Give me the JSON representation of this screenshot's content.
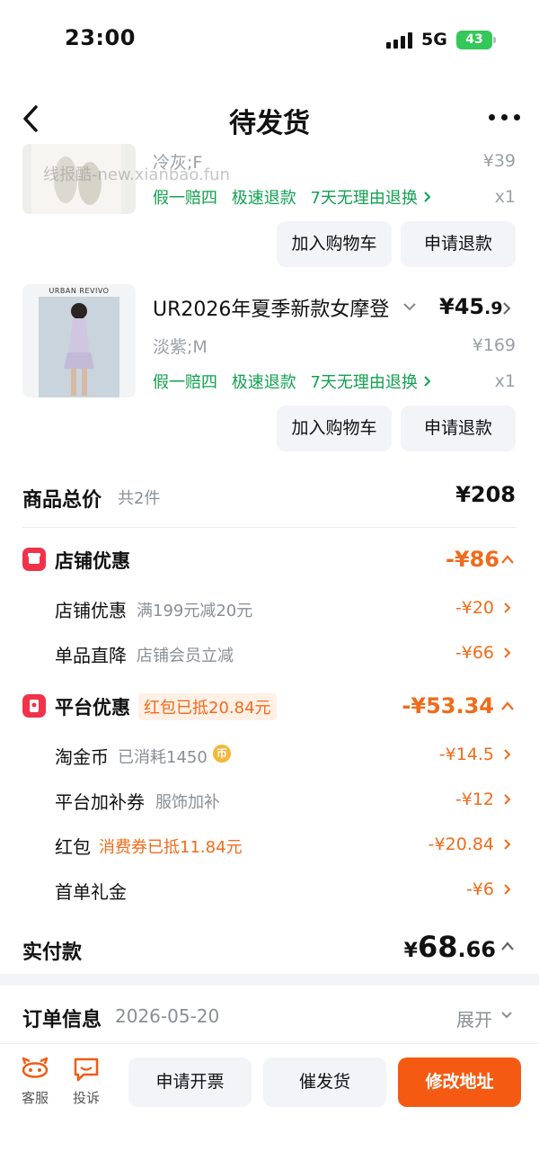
{
  "status": {
    "time": "23:00",
    "network": "5G",
    "battery": "43"
  },
  "nav": {
    "title": "待发货"
  },
  "watermark": "线报酷-new.xianbao.fun",
  "products": [
    {
      "spec": "冷灰;F",
      "orig_price": "¥39",
      "services": [
        "假一赔四",
        "极速退款",
        "7天无理由退换"
      ],
      "qty": "x1",
      "btn_cart": "加入购物车",
      "btn_refund": "申请退款"
    },
    {
      "brand": "URBAN REVIVO",
      "title": "UR2026年夏季新款女摩登",
      "price_main": "¥45",
      "price_dec": ".9",
      "spec": "淡紫;M",
      "orig_price": "¥169",
      "services": [
        "假一赔四",
        "极速退款",
        "7天无理由退换"
      ],
      "qty": "x1",
      "btn_cart": "加入购物车",
      "btn_refund": "申请退款"
    }
  ],
  "total": {
    "label": "商品总价",
    "count": "共2件",
    "amount": "¥208"
  },
  "shop_discount": {
    "label": "店铺优惠",
    "amount": "-¥86",
    "items": [
      {
        "label": "店铺优惠",
        "desc": "满199元减20元",
        "amount": "-¥20"
      },
      {
        "label": "单品直降",
        "desc": "店铺会员立减",
        "amount": "-¥66"
      }
    ]
  },
  "platform_discount": {
    "label": "平台优惠",
    "tag": "红包已抵20.84元",
    "amount": "-¥53.34",
    "items": [
      {
        "label": "淘金币",
        "desc": "已消耗1450",
        "coin": "币",
        "amount": "-¥14.5"
      },
      {
        "label": "平台加补券",
        "desc": "服饰加补",
        "amount": "-¥12"
      },
      {
        "label": "红包",
        "desc": "消费券已抵11.84元",
        "amount": "-¥20.84"
      },
      {
        "label": "首单礼金",
        "desc": "",
        "amount": "-¥6"
      }
    ]
  },
  "paid": {
    "label": "实付款",
    "currency": "¥",
    "main": "68",
    "dec": ".66"
  },
  "order_info": {
    "label": "订单信息",
    "date": "2026-05-20",
    "expand": "展开"
  },
  "bottom": {
    "service": "客服",
    "complain": "投诉",
    "invoice": "申请开票",
    "urge": "催发货",
    "change_address": "修改地址"
  },
  "colors": {
    "accent": "#f55a12",
    "green": "#12a150",
    "red_icon": "#f0334b"
  }
}
